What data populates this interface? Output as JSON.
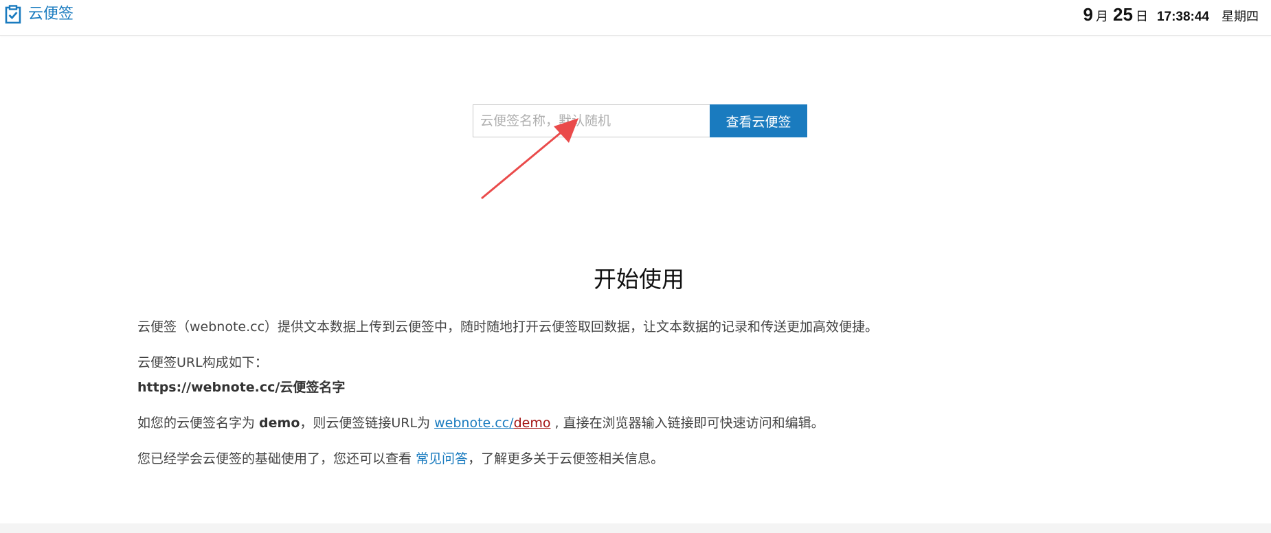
{
  "header": {
    "brand": "云便签",
    "date": {
      "month": "9",
      "month_unit": "月",
      "day": "25",
      "day_unit": "日",
      "time": "17:38:44",
      "weekday": "星期四"
    }
  },
  "search": {
    "placeholder": "云便签名称，默认随机",
    "value": "",
    "button_label": "查看云便签"
  },
  "intro": {
    "title": "开始使用",
    "line1": "云便签（webnote.cc）提供文本数据上传到云便签中，随时随地打开云便签取回数据，让文本数据的记录和传送更加高效便捷。",
    "line2": "云便签URL构成如下：",
    "url_pattern": "https://webnote.cc/云便签名字",
    "example_prefix": "如您的云便签名字为 ",
    "example_name": "demo",
    "example_middle": "，则云便签链接URL为 ",
    "example_link_base": "webnote.cc/",
    "example_link_name": "demo",
    "example_suffix": " , 直接在浏览器输入链接即可快速访问和编辑。",
    "learn_prefix": "您已经学会云便签的基础使用了，您还可以查看 ",
    "faq_link": "常见问答",
    "learn_suffix": "，了解更多关于云便签相关信息。"
  },
  "colors": {
    "accent": "#1a7bbf",
    "annotation_arrow": "#ea4b4b",
    "link_name": "#a30f0f"
  },
  "icons": {
    "brand": "clipboard-check-icon",
    "annotation": "red-arrow-icon"
  }
}
